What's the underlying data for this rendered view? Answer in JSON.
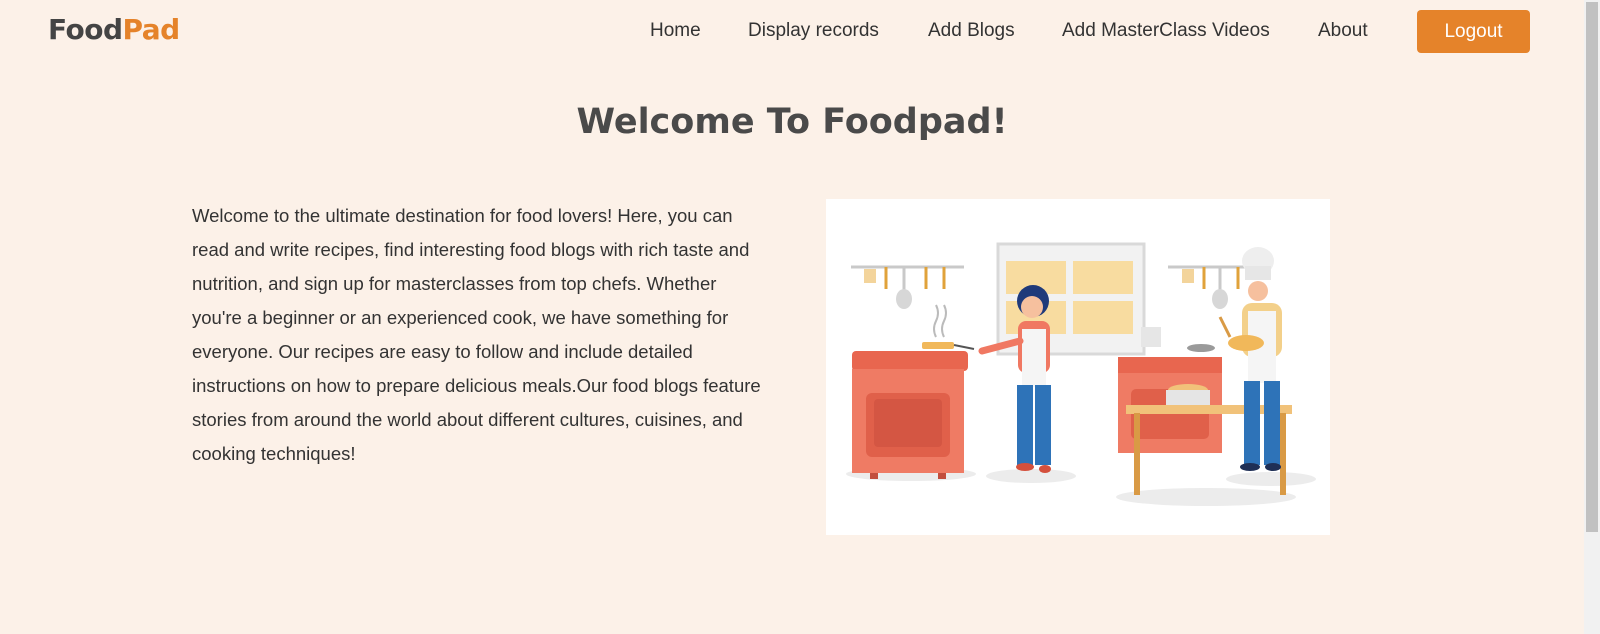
{
  "brand": {
    "part1": "Food",
    "part2": "Pad"
  },
  "nav": {
    "items": [
      "Home",
      "Display records",
      "Add Blogs",
      "Add MasterClass Videos",
      "About"
    ],
    "logout_label": "Logout"
  },
  "main": {
    "title": "Welcome To Foodpad!",
    "intro": "Welcome to the ultimate destination for food lovers! Here, you can read and write recipes, find interesting food blogs with rich taste and nutrition, and sign up for masterclasses from top chefs. Whether you're a beginner or an experienced cook, we have something for everyone. Our recipes are easy to follow and include detailed instructions on how to prepare delicious meals.Our food blogs feature stories from around the world about different cultures, cuisines, and cooking techniques!"
  },
  "colors": {
    "background": "#fcf1e8",
    "accent": "#e5832a",
    "text": "#333333"
  }
}
